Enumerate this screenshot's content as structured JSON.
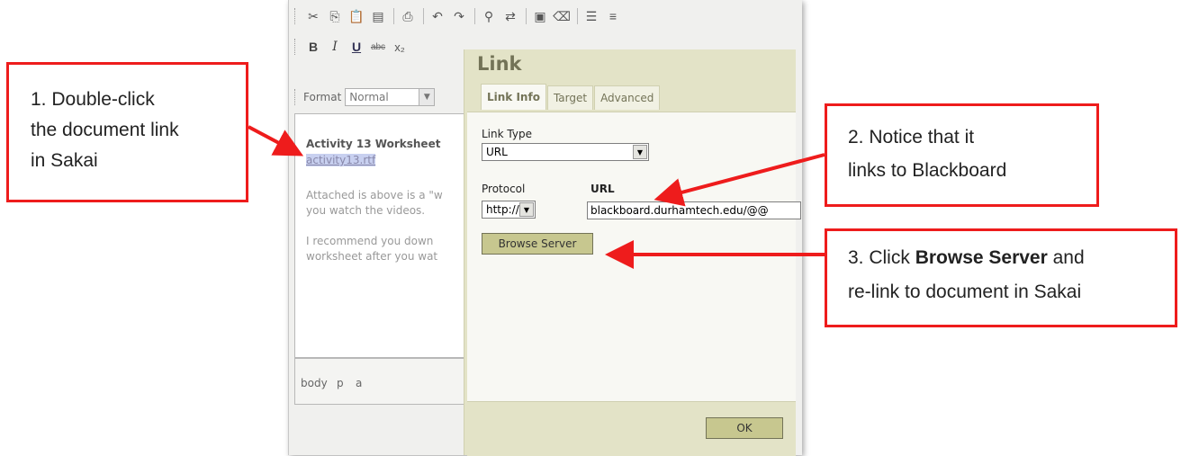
{
  "toolbar": {
    "row1_icons": [
      "cut-icon",
      "copy-icon",
      "paste-icon",
      "paste-word-icon",
      "print-icon",
      "undo-icon",
      "redo-icon",
      "find-icon",
      "replace-icon",
      "select-all-icon",
      "remove-format-icon",
      "numbered-list-icon",
      "bulleted-list-icon"
    ],
    "bold_label": "B",
    "italic_label": "I",
    "underline_label": "U",
    "strike_label": "abc",
    "subscript_label": "x₂",
    "format_label": "Format",
    "format_value": "Normal"
  },
  "document": {
    "title": "Activity 13 Worksheet",
    "link_text": "activity13.rtf",
    "para1_line1": "Attached is above is a \"w",
    "para1_line2": "you watch the videos.",
    "para2_line1": "I recommend you down",
    "para2_line2": "worksheet after you wat"
  },
  "status_bar": {
    "items": [
      "body",
      "p",
      "a"
    ]
  },
  "dialog": {
    "title": "Link",
    "tabs": [
      "Link Info",
      "Target",
      "Advanced"
    ],
    "link_type_label": "Link Type",
    "link_type_value": "URL",
    "protocol_label": "Protocol",
    "protocol_value": "http://",
    "url_label": "URL",
    "url_value": "blackboard.durhamtech.edu/@@",
    "browse_button": "Browse Server",
    "ok_button": "OK"
  },
  "callouts": {
    "step1_line1": "1. Double-click",
    "step1_line2": "the document link",
    "step1_line3": "in Sakai",
    "step2_line1": "2. Notice that it",
    "step2_line2": "links to Blackboard",
    "step3_prefix": "3. Click ",
    "step3_bold": "Browse Server",
    "step3_suffix": " and",
    "step3_line2": "re-link to document in Sakai"
  },
  "colors": {
    "callout_border": "#ee1c1c",
    "dialog_bg": "#e3e3c7",
    "dialog_title": "#737357",
    "button_bg": "#c7c78f"
  }
}
